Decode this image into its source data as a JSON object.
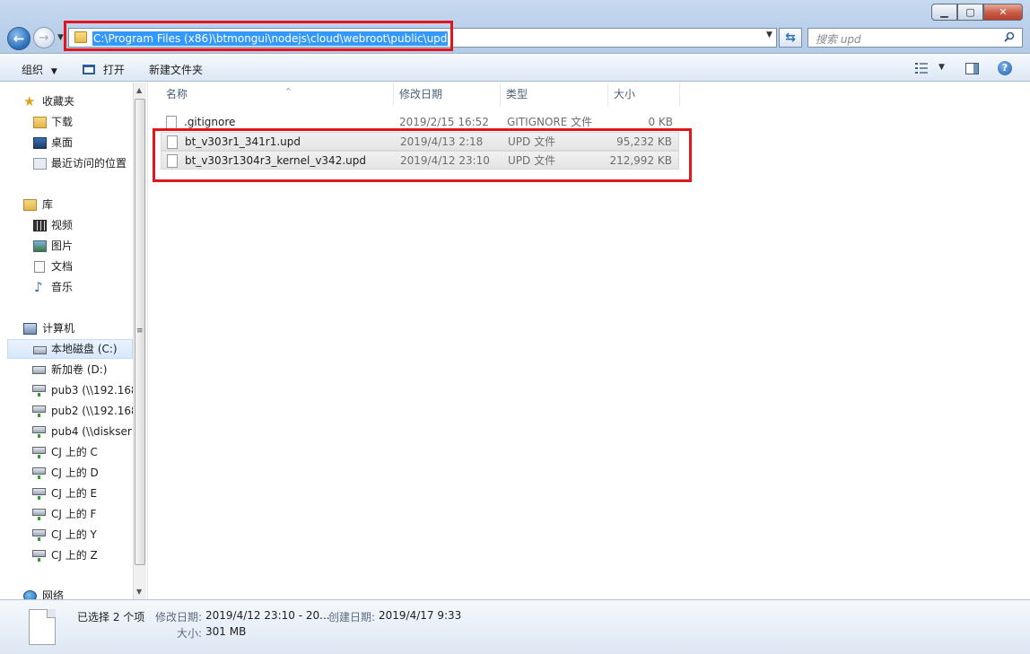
{
  "window": {
    "controls": [
      "minimize",
      "maximize",
      "close"
    ]
  },
  "address_bar": {
    "path": "C:\\Program Files (x86)\\btmongui\\nodejs\\cloud\\webroot\\public\\upd"
  },
  "search": {
    "placeholder": "搜索 upd"
  },
  "toolbar": {
    "organize_label": "组织",
    "open_label": "打开",
    "new_folder_label": "新建文件夹"
  },
  "sidebar": {
    "favorites": {
      "header": "收藏夹",
      "items": [
        {
          "label": "下载",
          "icon": "download-folder-icon"
        },
        {
          "label": "桌面",
          "icon": "desktop-icon"
        },
        {
          "label": "最近访问的位置",
          "icon": "recent-places-icon"
        }
      ]
    },
    "libraries": {
      "header": "库",
      "items": [
        {
          "label": "视频",
          "icon": "video-icon"
        },
        {
          "label": "图片",
          "icon": "picture-icon"
        },
        {
          "label": "文档",
          "icon": "document-icon"
        },
        {
          "label": "音乐",
          "icon": "music-icon"
        }
      ]
    },
    "computer": {
      "header": "计算机",
      "items": [
        {
          "label": "本地磁盘 (C:)",
          "icon": "local-disk-icon",
          "selected": true
        },
        {
          "label": "新加卷 (D:)",
          "icon": "drive-icon"
        },
        {
          "label": "pub3 (\\\\192.168",
          "icon": "network-drive-icon"
        },
        {
          "label": "pub2 (\\\\192.168",
          "icon": "network-drive-icon"
        },
        {
          "label": "pub4 (\\\\diskser",
          "icon": "network-drive-icon"
        },
        {
          "label": "CJ 上的 C",
          "icon": "network-drive-icon"
        },
        {
          "label": "CJ 上的 D",
          "icon": "network-drive-icon"
        },
        {
          "label": "CJ 上的 E",
          "icon": "network-drive-icon"
        },
        {
          "label": "CJ 上的 F",
          "icon": "network-drive-icon"
        },
        {
          "label": "CJ 上的 Y",
          "icon": "network-drive-icon"
        },
        {
          "label": "CJ 上的 Z",
          "icon": "network-drive-icon"
        }
      ]
    },
    "network": {
      "header": "网络"
    }
  },
  "file_list": {
    "columns": {
      "name": "名称",
      "date": "修改日期",
      "type": "类型",
      "size": "大小"
    },
    "rows": [
      {
        "name": ".gitignore",
        "date": "2019/2/15 16:52",
        "type": "GITIGNORE 文件",
        "size": "0 KB",
        "selected": false
      },
      {
        "name": "bt_v303r1_341r1.upd",
        "date": "2019/4/13 2:18",
        "type": "UPD 文件",
        "size": "95,232 KB",
        "selected": true
      },
      {
        "name": "bt_v303r1304r3_kernel_v342.upd",
        "date": "2019/4/12 23:10",
        "type": "UPD 文件",
        "size": "212,992 KB",
        "selected": true
      }
    ]
  },
  "details": {
    "selected_text": "已选择 2 个项",
    "modified_label": "修改日期:",
    "modified_value": "2019/4/12 23:10 - 20...",
    "created_label": "创建日期:",
    "created_value": "2019/4/17 9:33",
    "size_label": "大小:",
    "size_value": "301 MB"
  },
  "colors": {
    "highlight_frame": "#e2141c",
    "path_selection": "#3399ff"
  }
}
